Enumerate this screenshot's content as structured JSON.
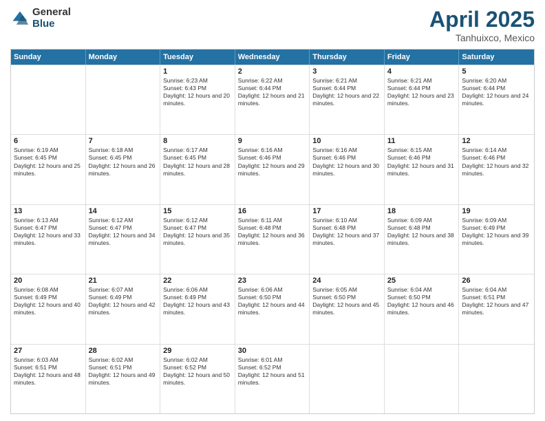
{
  "logo": {
    "general": "General",
    "blue": "Blue"
  },
  "title": {
    "month": "April 2025",
    "location": "Tanhuixco, Mexico"
  },
  "header_days": [
    "Sunday",
    "Monday",
    "Tuesday",
    "Wednesday",
    "Thursday",
    "Friday",
    "Saturday"
  ],
  "weeks": [
    [
      {
        "day": "",
        "sunrise": "",
        "sunset": "",
        "daylight": ""
      },
      {
        "day": "",
        "sunrise": "",
        "sunset": "",
        "daylight": ""
      },
      {
        "day": "1",
        "sunrise": "Sunrise: 6:23 AM",
        "sunset": "Sunset: 6:43 PM",
        "daylight": "Daylight: 12 hours and 20 minutes."
      },
      {
        "day": "2",
        "sunrise": "Sunrise: 6:22 AM",
        "sunset": "Sunset: 6:44 PM",
        "daylight": "Daylight: 12 hours and 21 minutes."
      },
      {
        "day": "3",
        "sunrise": "Sunrise: 6:21 AM",
        "sunset": "Sunset: 6:44 PM",
        "daylight": "Daylight: 12 hours and 22 minutes."
      },
      {
        "day": "4",
        "sunrise": "Sunrise: 6:21 AM",
        "sunset": "Sunset: 6:44 PM",
        "daylight": "Daylight: 12 hours and 23 minutes."
      },
      {
        "day": "5",
        "sunrise": "Sunrise: 6:20 AM",
        "sunset": "Sunset: 6:44 PM",
        "daylight": "Daylight: 12 hours and 24 minutes."
      }
    ],
    [
      {
        "day": "6",
        "sunrise": "Sunrise: 6:19 AM",
        "sunset": "Sunset: 6:45 PM",
        "daylight": "Daylight: 12 hours and 25 minutes."
      },
      {
        "day": "7",
        "sunrise": "Sunrise: 6:18 AM",
        "sunset": "Sunset: 6:45 PM",
        "daylight": "Daylight: 12 hours and 26 minutes."
      },
      {
        "day": "8",
        "sunrise": "Sunrise: 6:17 AM",
        "sunset": "Sunset: 6:45 PM",
        "daylight": "Daylight: 12 hours and 28 minutes."
      },
      {
        "day": "9",
        "sunrise": "Sunrise: 6:16 AM",
        "sunset": "Sunset: 6:46 PM",
        "daylight": "Daylight: 12 hours and 29 minutes."
      },
      {
        "day": "10",
        "sunrise": "Sunrise: 6:16 AM",
        "sunset": "Sunset: 6:46 PM",
        "daylight": "Daylight: 12 hours and 30 minutes."
      },
      {
        "day": "11",
        "sunrise": "Sunrise: 6:15 AM",
        "sunset": "Sunset: 6:46 PM",
        "daylight": "Daylight: 12 hours and 31 minutes."
      },
      {
        "day": "12",
        "sunrise": "Sunrise: 6:14 AM",
        "sunset": "Sunset: 6:46 PM",
        "daylight": "Daylight: 12 hours and 32 minutes."
      }
    ],
    [
      {
        "day": "13",
        "sunrise": "Sunrise: 6:13 AM",
        "sunset": "Sunset: 6:47 PM",
        "daylight": "Daylight: 12 hours and 33 minutes."
      },
      {
        "day": "14",
        "sunrise": "Sunrise: 6:12 AM",
        "sunset": "Sunset: 6:47 PM",
        "daylight": "Daylight: 12 hours and 34 minutes."
      },
      {
        "day": "15",
        "sunrise": "Sunrise: 6:12 AM",
        "sunset": "Sunset: 6:47 PM",
        "daylight": "Daylight: 12 hours and 35 minutes."
      },
      {
        "day": "16",
        "sunrise": "Sunrise: 6:11 AM",
        "sunset": "Sunset: 6:48 PM",
        "daylight": "Daylight: 12 hours and 36 minutes."
      },
      {
        "day": "17",
        "sunrise": "Sunrise: 6:10 AM",
        "sunset": "Sunset: 6:48 PM",
        "daylight": "Daylight: 12 hours and 37 minutes."
      },
      {
        "day": "18",
        "sunrise": "Sunrise: 6:09 AM",
        "sunset": "Sunset: 6:48 PM",
        "daylight": "Daylight: 12 hours and 38 minutes."
      },
      {
        "day": "19",
        "sunrise": "Sunrise: 6:09 AM",
        "sunset": "Sunset: 6:49 PM",
        "daylight": "Daylight: 12 hours and 39 minutes."
      }
    ],
    [
      {
        "day": "20",
        "sunrise": "Sunrise: 6:08 AM",
        "sunset": "Sunset: 6:49 PM",
        "daylight": "Daylight: 12 hours and 40 minutes."
      },
      {
        "day": "21",
        "sunrise": "Sunrise: 6:07 AM",
        "sunset": "Sunset: 6:49 PM",
        "daylight": "Daylight: 12 hours and 42 minutes."
      },
      {
        "day": "22",
        "sunrise": "Sunrise: 6:06 AM",
        "sunset": "Sunset: 6:49 PM",
        "daylight": "Daylight: 12 hours and 43 minutes."
      },
      {
        "day": "23",
        "sunrise": "Sunrise: 6:06 AM",
        "sunset": "Sunset: 6:50 PM",
        "daylight": "Daylight: 12 hours and 44 minutes."
      },
      {
        "day": "24",
        "sunrise": "Sunrise: 6:05 AM",
        "sunset": "Sunset: 6:50 PM",
        "daylight": "Daylight: 12 hours and 45 minutes."
      },
      {
        "day": "25",
        "sunrise": "Sunrise: 6:04 AM",
        "sunset": "Sunset: 6:50 PM",
        "daylight": "Daylight: 12 hours and 46 minutes."
      },
      {
        "day": "26",
        "sunrise": "Sunrise: 6:04 AM",
        "sunset": "Sunset: 6:51 PM",
        "daylight": "Daylight: 12 hours and 47 minutes."
      }
    ],
    [
      {
        "day": "27",
        "sunrise": "Sunrise: 6:03 AM",
        "sunset": "Sunset: 6:51 PM",
        "daylight": "Daylight: 12 hours and 48 minutes."
      },
      {
        "day": "28",
        "sunrise": "Sunrise: 6:02 AM",
        "sunset": "Sunset: 6:51 PM",
        "daylight": "Daylight: 12 hours and 49 minutes."
      },
      {
        "day": "29",
        "sunrise": "Sunrise: 6:02 AM",
        "sunset": "Sunset: 6:52 PM",
        "daylight": "Daylight: 12 hours and 50 minutes."
      },
      {
        "day": "30",
        "sunrise": "Sunrise: 6:01 AM",
        "sunset": "Sunset: 6:52 PM",
        "daylight": "Daylight: 12 hours and 51 minutes."
      },
      {
        "day": "",
        "sunrise": "",
        "sunset": "",
        "daylight": ""
      },
      {
        "day": "",
        "sunrise": "",
        "sunset": "",
        "daylight": ""
      },
      {
        "day": "",
        "sunrise": "",
        "sunset": "",
        "daylight": ""
      }
    ]
  ]
}
